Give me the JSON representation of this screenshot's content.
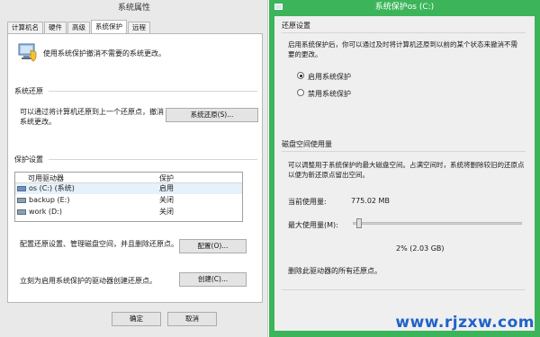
{
  "left_window": {
    "title": "系统属性",
    "tabs": [
      "计算机名",
      "硬件",
      "高级",
      "系统保护",
      "远程"
    ],
    "intro": "使用系统保护撤消不需要的系统更改。",
    "restore": {
      "heading": "系统还原",
      "desc_line1": "可以通过将计算机还原到上一个还原点，撤消",
      "desc_line2": "系统更改。",
      "button": "系统还原(S)..."
    },
    "protection": {
      "heading": "保护设置",
      "col_drive": "可用驱动器",
      "col_status": "保护",
      "drives": [
        {
          "name": "os (C:) (系统)",
          "status": "启用",
          "selected": true
        },
        {
          "name": "backup (E:)",
          "status": "关闭",
          "selected": false
        },
        {
          "name": "work (D:)",
          "status": "关闭",
          "selected": false
        }
      ],
      "config_text": "配置还原设置、管理磁盘空间，并且删除还原点。",
      "config_button": "配置(O)...",
      "create_text": "立刻为启用系统保护的驱动器创建还原点。",
      "create_button": "创建(C)..."
    },
    "ok_button": "确定",
    "cancel_button": "取消"
  },
  "right_window": {
    "title": "系统保护os (C:)",
    "restore_settings": {
      "heading": "还原设置",
      "desc_line1": "启用系统保护后，你可以通过及时将计算机还原到以前的某个状态来撤消不需",
      "desc_line2": "要的更改。",
      "option_on": "启用系统保护",
      "option_off": "禁用系统保护",
      "selected": "on"
    },
    "disk_usage": {
      "heading": "磁盘空间使用量",
      "desc_line1": "可以调整用于系统保护的最大磁盘空间。占满空间时，系统将删除较旧的还原点",
      "desc_line2": "以便为新还原点留出空间。",
      "current_label": "当前使用量:",
      "current_value": "775.02 MB",
      "max_label": "最大使用量(M):",
      "max_fraction": 0.02,
      "max_value": "2% (2.03 GB)",
      "delete_text": "删除此驱动器的所有还原点。"
    }
  },
  "watermark": "www.rjzxw.com",
  "colors": {
    "accent_green": "#3cb55a",
    "watermark_blue": "#1f63c9",
    "selected_row": "#e5f1fb"
  }
}
